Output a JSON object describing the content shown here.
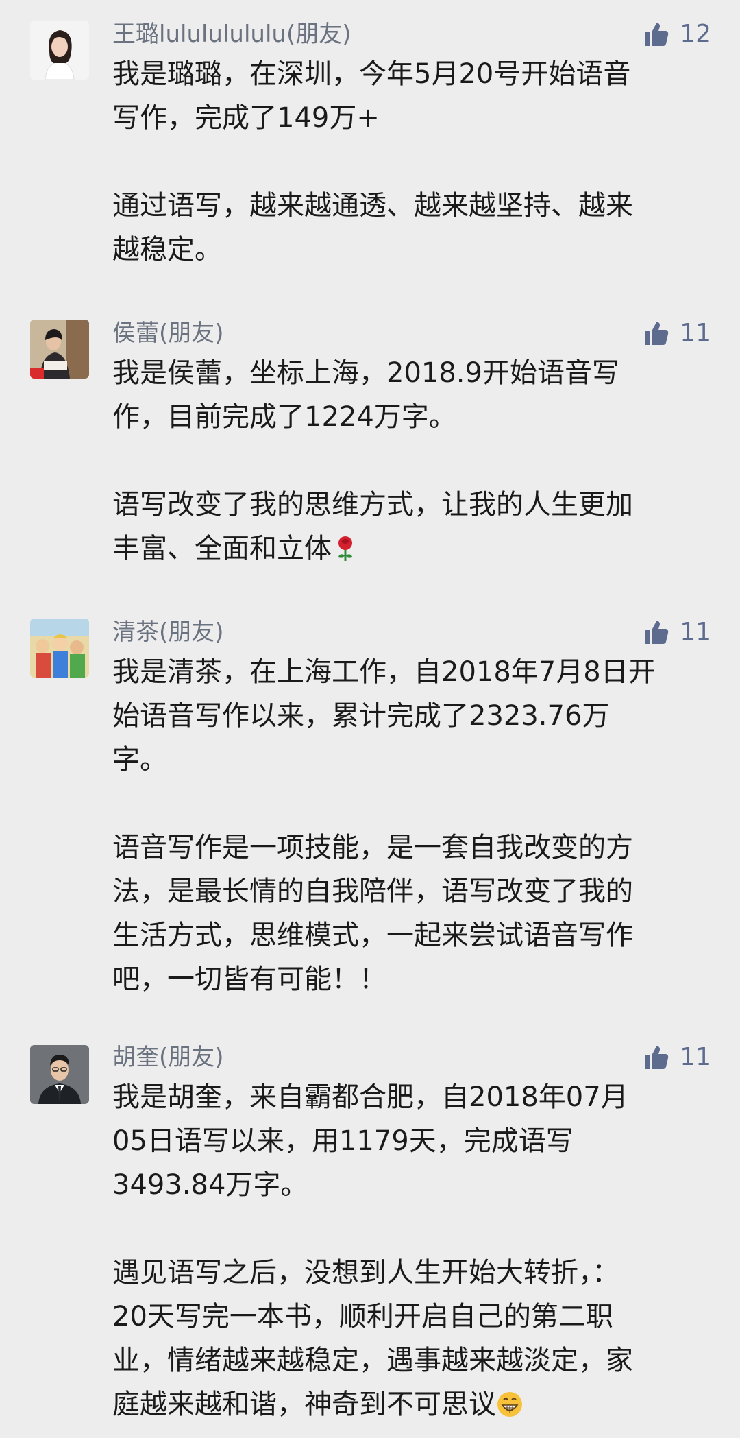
{
  "comments": [
    {
      "author": "王璐lulululululu(朋友)",
      "likes": "12",
      "paragraphs": [
        "我是璐璐，在深圳，今年5月20号开始语音\n写作，完成了149万+",
        "通过语写，越来越通透、越来越坚持、越来\n越稳定。"
      ]
    },
    {
      "author": "侯蕾(朋友)",
      "likes": "11",
      "paragraphs": [
        "我是侯蕾，坐标上海，2018.9开始语音写\n作，目前完成了1224万字。",
        "语写改变了我的思维方式，让我的人生更加\n丰富、全面和立体"
      ]
    },
    {
      "author": "清茶(朋友)",
      "likes": "11",
      "paragraphs": [
        "我是清茶，在上海工作，自2018年7月8日开\n始语音写作以来，累计完成了2323.76万\n字。",
        "语音写作是一项技能，是一套自我改变的方\n法，是最长情的自我陪伴，语写改变了我的\n生活方式，思维模式，一起来尝试语音写作\n吧，一切皆有可能！！"
      ]
    },
    {
      "author": "胡奎(朋友)",
      "likes": "11",
      "paragraphs": [
        "我是胡奎，来自霸都合肥，自2018年07月\n05日语写以来，用1179天，完成语写\n3493.84万字。",
        "遇见语写之后，没想到人生开始大转折，：\n20天写完一本书，顺利开启自己的第二职\n业，情绪越来越稳定，遇事越来越淡定，家\n庭越来越和谐，神奇到不可思议"
      ]
    }
  ],
  "colors": {
    "background": "#ededed",
    "author": "#6b7380",
    "like": "#5d6b8e",
    "text": "#1a1a1a"
  }
}
